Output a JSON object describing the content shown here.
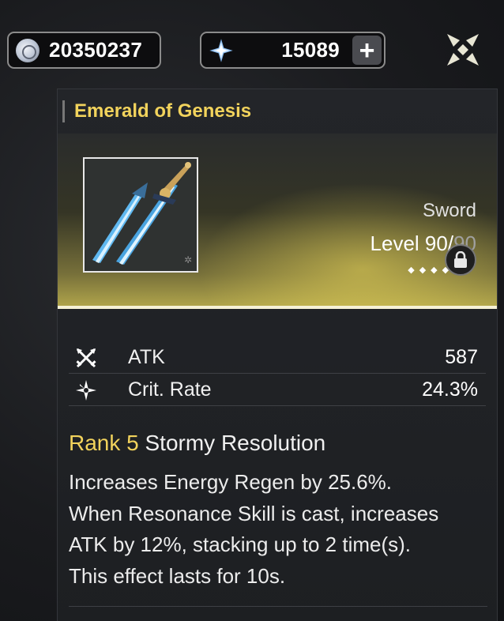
{
  "currency": {
    "shell_credits": "20350237",
    "astrite": "15089",
    "add_label": "+"
  },
  "weapon": {
    "name": "Emerald of Genesis",
    "type": "Sword",
    "level_label": "Level",
    "level_current": "90",
    "level_sep": "/",
    "level_max": "90",
    "rank_stars": "◆◆◆◆◆◆",
    "locked": true
  },
  "stats": [
    {
      "icon": "crossed-swords-icon",
      "label": "ATK",
      "value": "587"
    },
    {
      "icon": "crit-star-icon",
      "label": "Crit. Rate",
      "value": "24.3%"
    }
  ],
  "passive": {
    "rank_label": "Rank 5",
    "name": "Stormy Resolution",
    "lines": [
      "Increases Energy Regen by 25.6%.",
      "When Resonance Skill is cast, increases",
      "ATK by 12%, stacking up to 2 time(s).",
      "This effect lasts for 10s."
    ]
  },
  "colors": {
    "accent_gold": "#f2d35c",
    "banner_glow": "#b4a84c"
  }
}
